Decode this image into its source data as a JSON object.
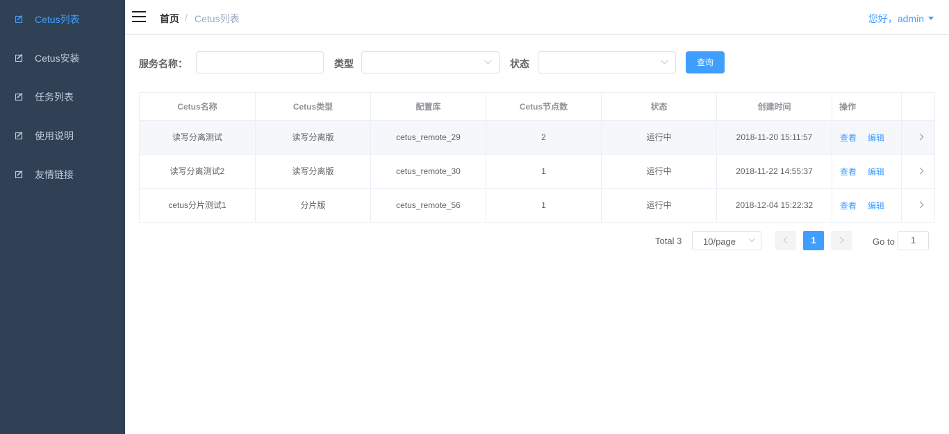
{
  "sidebar": {
    "items": [
      {
        "label": "Cetus列表",
        "active": true
      },
      {
        "label": "Cetus安装"
      },
      {
        "label": "任务列表"
      },
      {
        "label": "使用说明"
      },
      {
        "label": "友情链接"
      }
    ]
  },
  "header": {
    "breadcrumb_home": "首页",
    "breadcrumb_sep": "/",
    "breadcrumb_current": "Cetus列表",
    "user_greeting": "您好，admin"
  },
  "filters": {
    "service_name_label": "服务名称：",
    "service_name_value": "",
    "type_label": "类型",
    "type_value": "",
    "status_label": "状态",
    "status_value": "",
    "query_button": "查询"
  },
  "table": {
    "columns": [
      "Cetus名称",
      "Cetus类型",
      "配置库",
      "Cetus节点数",
      "状态",
      "创建时间",
      "操作",
      ""
    ],
    "rows": [
      {
        "name": "读写分离测试",
        "type": "读写分离版",
        "config_db": "cetus_remote_29",
        "nodes": "2",
        "status": "运行中",
        "created": "2018-11-20 15:11:57"
      },
      {
        "name": "读写分离测试2",
        "type": "读写分离版",
        "config_db": "cetus_remote_30",
        "nodes": "1",
        "status": "运行中",
        "created": "2018-11-22 14:55:37"
      },
      {
        "name": "cetus分片测试1",
        "type": "分片版",
        "config_db": "cetus_remote_56",
        "nodes": "1",
        "status": "运行中",
        "created": "2018-12-04 15:22:32"
      }
    ],
    "view_label": "查看",
    "edit_label": "编辑"
  },
  "pagination": {
    "total": "Total 3",
    "page_size": "10/page",
    "current_page": "1",
    "goto_label": "Go to",
    "goto_value": "1"
  },
  "colors": {
    "sidebar_bg": "#304156",
    "accent": "#409eff"
  },
  "icons": {
    "sidebar": "edit-icon",
    "menu": "hamburger-icon"
  }
}
